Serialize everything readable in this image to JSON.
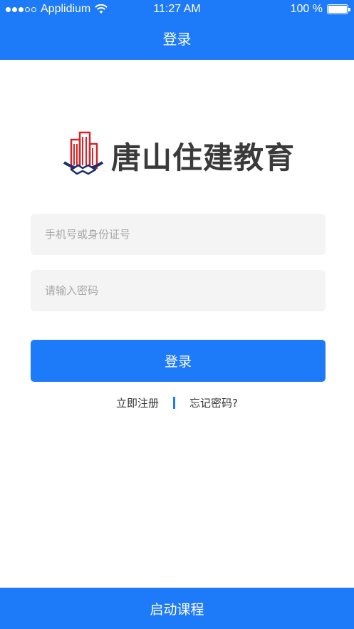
{
  "status_bar": {
    "carrier": "Applidium",
    "time": "11:27 AM",
    "battery": "100 %",
    "icons": [
      "signal-dots",
      "wifi-icon",
      "battery-icon"
    ]
  },
  "nav": {
    "title": "登录"
  },
  "logo": {
    "text": "唐山住建教育",
    "icon": "building-handshake-logo"
  },
  "form": {
    "phone_placeholder": "手机号或身份证号",
    "phone_value": "",
    "password_placeholder": "请输入密码",
    "password_value": "",
    "login_label": "登录"
  },
  "links": {
    "register": "立即注册",
    "forgot": "忘记密码?"
  },
  "bottom": {
    "label": "启动课程"
  },
  "colors": {
    "primary": "#1d7af8",
    "field_bg": "#f4f4f4",
    "logo_red": "#d7262b",
    "logo_navy": "#1c2f6e"
  }
}
